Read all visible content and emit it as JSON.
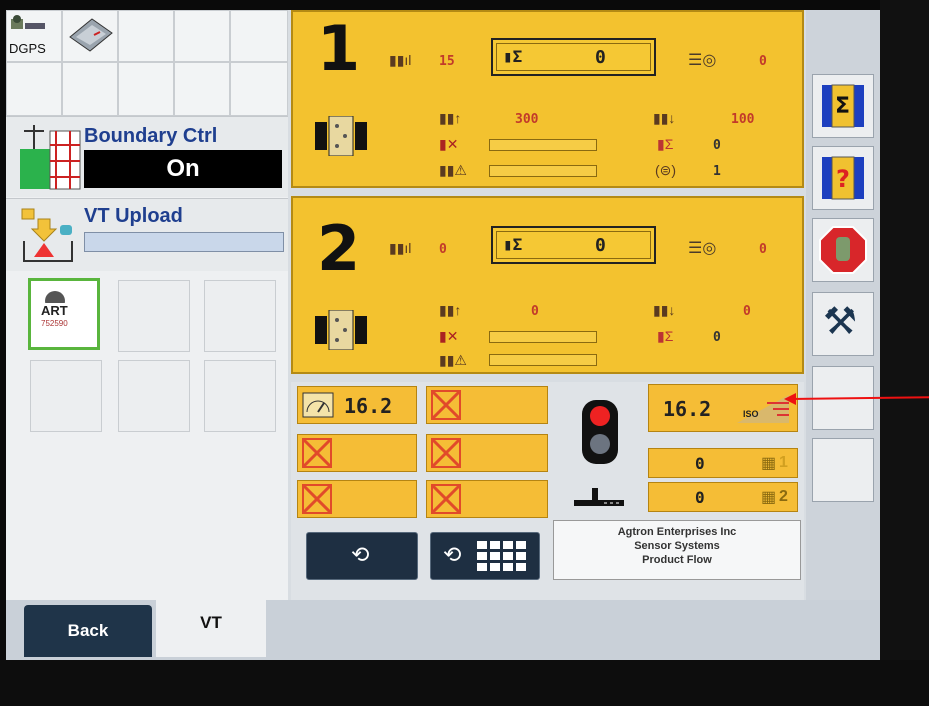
{
  "left_panel": {
    "dgps_label": "DGPS",
    "boundary": {
      "title": "Boundary Ctrl",
      "state": "On"
    },
    "vt_upload": {
      "title": "VT Upload",
      "progress": 0.0
    },
    "implement_slot_label": "ART",
    "implement_slot_sub": "752590"
  },
  "section1": {
    "number": "1",
    "rate_count": "15",
    "sum_value": "0",
    "count_value": "0",
    "up_value": "300",
    "down_value": "100",
    "sum_flow": "0",
    "bottom_count": "1"
  },
  "section2": {
    "number": "2",
    "rate_count": "0",
    "sum_value": "0",
    "count_value": "0",
    "up_value": "0",
    "down_value": "0",
    "sum_flow": "0"
  },
  "lower": {
    "speed_value": "16.2",
    "iso_speed_value": "16.2",
    "iso_label": "ISO",
    "counter1": "0",
    "counter2": "0",
    "counter1_index": "1",
    "counter2_index": "2"
  },
  "company": {
    "line1": "Agtron Enterprises Inc",
    "line2": "Sensor Systems",
    "line3": "Product Flow"
  },
  "tabs": {
    "back": "Back",
    "vt": "VT"
  },
  "colors": {
    "panel_yellow": "#f3c22f",
    "tab_dark": "#1f3449",
    "annotation_arrow": "#ee1111"
  }
}
